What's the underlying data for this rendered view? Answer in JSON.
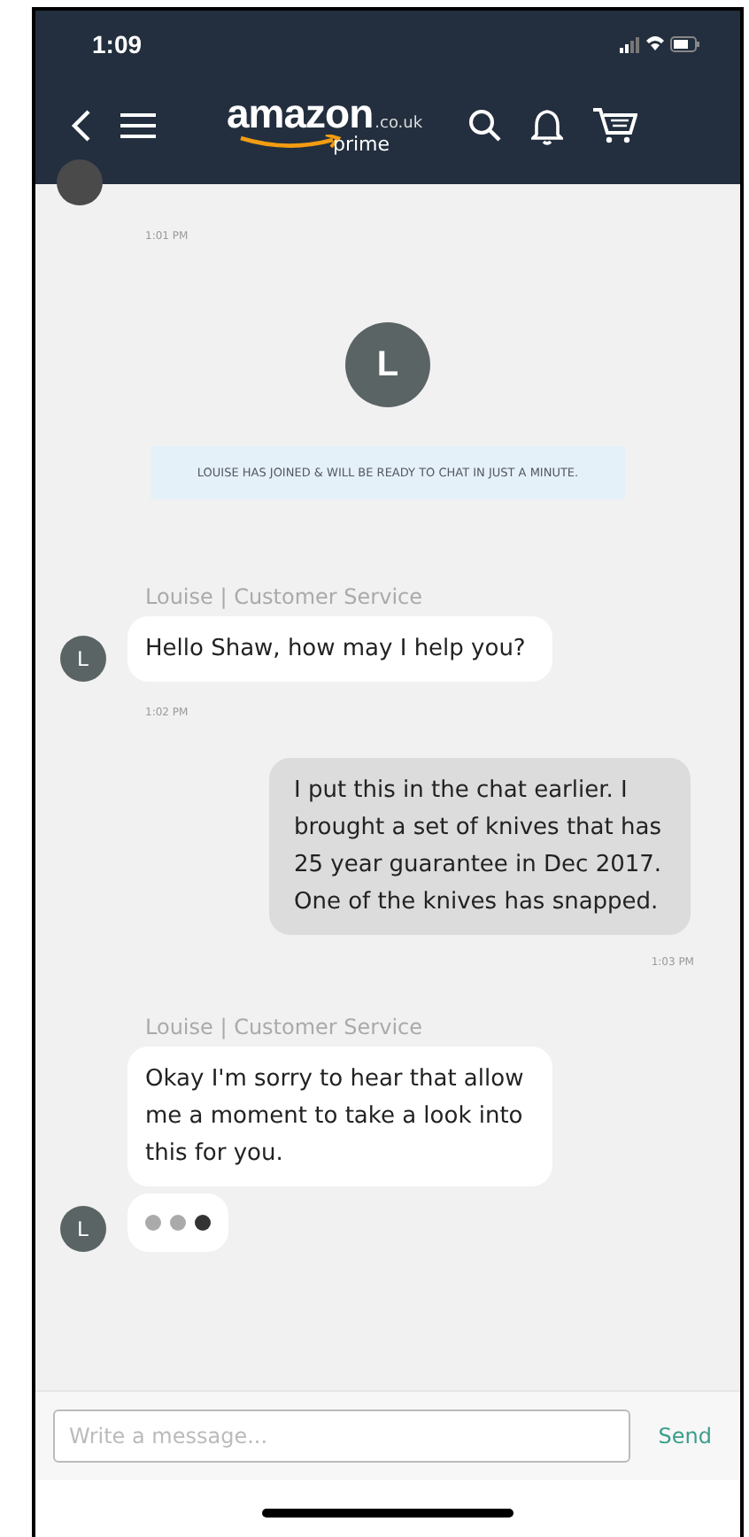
{
  "status_bar": {
    "time": "1:09"
  },
  "header": {
    "logo": {
      "word": "amazon",
      "domain": ".co.uk",
      "tier": "prime"
    }
  },
  "messages": [
    {
      "kind": "time_only",
      "time": "1:01 PM"
    },
    {
      "kind": "system",
      "avatar": "L",
      "text": "LOUISE HAS JOINED & WILL BE READY TO CHAT IN JUST A MINUTE."
    },
    {
      "kind": "agent",
      "sender": "Louise | Customer Service",
      "avatar": "L",
      "text": "Hello Shaw, how may I help you?",
      "time": "1:02 PM"
    },
    {
      "kind": "user",
      "text": "I put this in the chat earlier. I brought a set of knives that has 25 year guarantee in Dec 2017. One of the knives has snapped.",
      "time": "1:03 PM"
    },
    {
      "kind": "agent",
      "sender": "Louise | Customer Service",
      "text": "Okay I'm sorry to hear that allow me a moment to take a look into this for you."
    },
    {
      "kind": "typing",
      "avatar": "L",
      "dots": [
        {
          "on": false
        },
        {
          "on": false
        },
        {
          "on": true
        }
      ]
    }
  ],
  "composer": {
    "placeholder": "Write a message...",
    "send": "Send"
  }
}
